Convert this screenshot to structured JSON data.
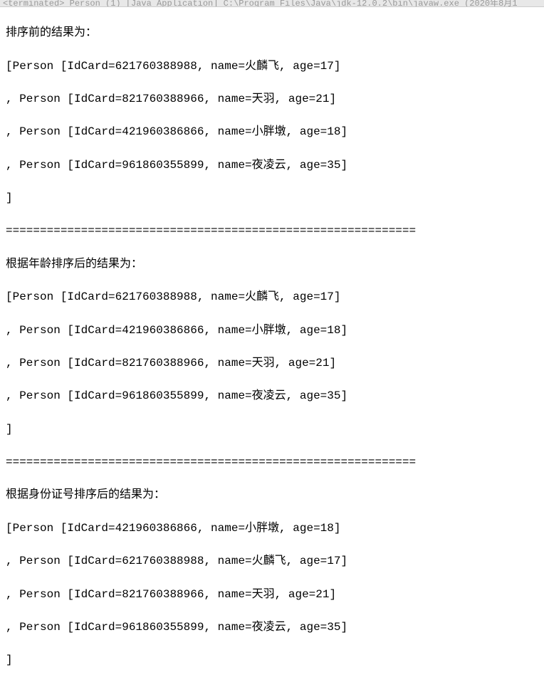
{
  "header": {
    "text": "<terminated> Person (1) [Java Application] C:\\Program Files\\Java\\jdk-12.0.2\\bin\\javaw.exe (2020年8月1"
  },
  "sections": {
    "before": {
      "title": "排序前的结果为：",
      "lines": [
        "[Person [IdCard=621760388988, name=火麟飞, age=17]",
        ", Person [IdCard=821760388966, name=天羽, age=21]",
        ", Person [IdCard=421960386866, name=小胖墩, age=18]",
        ", Person [IdCard=961860355899, name=夜凌云, age=35]",
        "]"
      ]
    },
    "divider1": "============================================================",
    "byAge": {
      "title": "根据年龄排序后的结果为：",
      "lines": [
        "[Person [IdCard=621760388988, name=火麟飞, age=17]",
        ", Person [IdCard=421960386866, name=小胖墩, age=18]",
        ", Person [IdCard=821760388966, name=天羽, age=21]",
        ", Person [IdCard=961860355899, name=夜凌云, age=35]",
        "]"
      ]
    },
    "divider2": "============================================================",
    "byId": {
      "title": "根据身份证号排序后的结果为：",
      "lines": [
        "[Person [IdCard=421960386866, name=小胖墩, age=18]",
        ", Person [IdCard=621760388988, name=火麟飞, age=17]",
        ", Person [IdCard=821760388966, name=天羽, age=21]",
        ", Person [IdCard=961860355899, name=夜凌云, age=35]",
        "]"
      ]
    }
  }
}
